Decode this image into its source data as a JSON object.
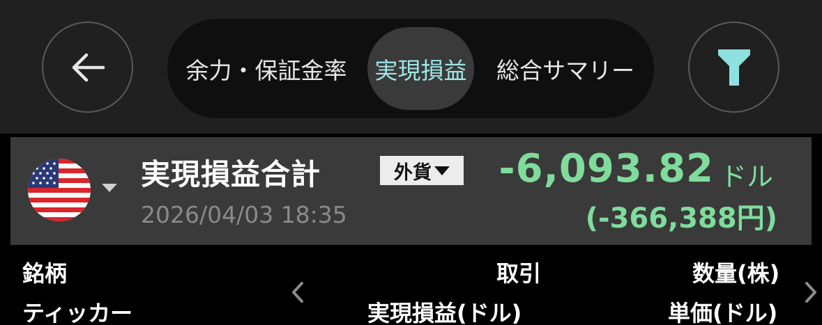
{
  "header": {
    "back_icon": "arrow-left-icon",
    "tabs": [
      {
        "label": "余力・保証金率",
        "active": false
      },
      {
        "label": "実現損益",
        "active": true
      },
      {
        "label": "総合サマリー",
        "active": false
      }
    ],
    "filter_icon": "funnel-icon",
    "filter_color": "#8fe0e0"
  },
  "summary": {
    "flag": "us-flag-icon",
    "title": "実現損益合計",
    "currency_select": "外貨",
    "date": "2026/04/03 18:35",
    "amount": "-6,093.82",
    "amount_unit": "ドル",
    "amount_yen": "(-366,388円)",
    "gain_loss_color": "#7fdc9c"
  },
  "table_header": {
    "col1_top": "銘柄",
    "col1_bottom": "ティッカー",
    "col2_top": "取引",
    "col2_bottom": "実現損益(ドル)",
    "col3_top": "数量(株)",
    "col3_bottom": "単価(ドル)",
    "prev_icon": "chevron-left-icon",
    "next_icon": "chevron-right-icon"
  }
}
